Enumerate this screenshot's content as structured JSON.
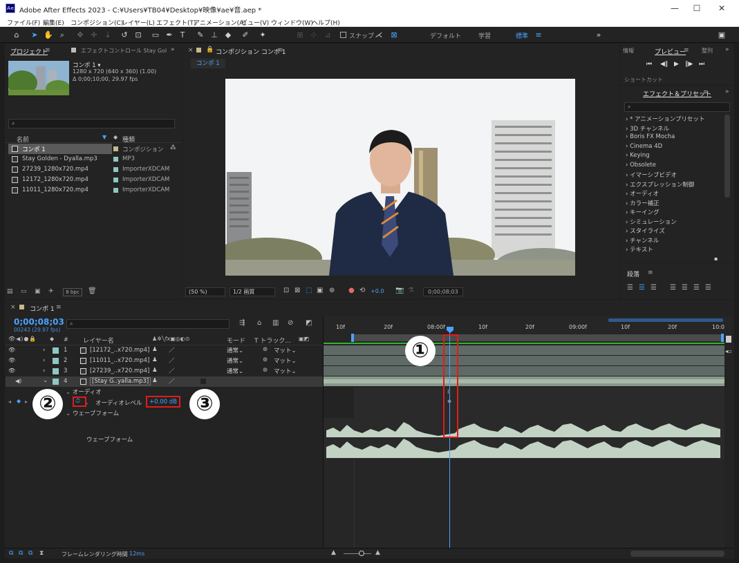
{
  "window": {
    "title": "Adobe After Effects 2023 - C:¥Users¥TB04¥Desktop¥映像¥ae¥音.aep *",
    "app_badge": "Ae",
    "minimize": "—",
    "maximize": "☐",
    "close": "✕"
  },
  "menu": [
    "ファイル(F)",
    "編集(E)",
    "コンポジション(C)",
    "レイヤー(L)",
    "エフェクト(T)",
    "アニメーション(A)",
    "ビュー(V)",
    "ウィンドウ(W)",
    "ヘルプ(H)"
  ],
  "toolbar": {
    "snap_label": "スナップ",
    "workspaces": [
      "デフォルト",
      "学習",
      "標準"
    ],
    "active_workspace": "標準"
  },
  "project_panel": {
    "tab_project": "プロジェクト",
    "tab_effect_controls": "エフェクトコントロール Stay Gol",
    "comp_name": "コンポ 1 ▾",
    "comp_size": "1280 x 720  (640 x 360) (1.00)",
    "comp_duration": "Δ 0;00;10;00, 29.97 fps",
    "search_placeholder": "",
    "col_name": "名前",
    "col_type": "種類",
    "items": [
      {
        "name": "コンポ 1",
        "type": "コンポジション",
        "color": "#c9b88c"
      },
      {
        "name": "Stay Golden - Dyalla.mp3",
        "type": "MP3",
        "color": "#8fc7c2"
      },
      {
        "name": "27239_1280x720.mp4",
        "type": "ImporterXDCAM",
        "color": "#8fc7c2"
      },
      {
        "name": "12172_1280x720.mp4",
        "type": "ImporterXDCAM",
        "color": "#8fc7c2"
      },
      {
        "name": "11011_1280x720.mp4",
        "type": "ImporterXDCAM",
        "color": "#8fc7c2"
      }
    ],
    "bpc": "8 bpc"
  },
  "comp_panel": {
    "tab_label": "コンポジション コンポ 1",
    "comp_chip": "コンポ 1",
    "zoom": "(50 %)",
    "resolution": "1/2 画質",
    "exposure": "+0.0",
    "timecode": "0;00;08;03"
  },
  "right_panel": {
    "tab_info": "情報",
    "tab_preview": "プレビュー",
    "tab_audio": "整列",
    "shortcut_label": "ショートカット",
    "effects_title": "エフェクト＆プリセット",
    "effects": [
      "* アニメーションプリセット",
      "3D チャンネル",
      "Boris FX Mocha",
      "Cinema 4D",
      "Keying",
      "Obsolete",
      "イマーシブビデオ",
      "エクスプレッション制御",
      "オーディオ",
      "カラー補正",
      "キーイング",
      "シミュレーション",
      "スタイライズ",
      "チャンネル",
      "テキスト"
    ],
    "paragraph_title": "段落"
  },
  "timeline": {
    "tab_label": "コンポ 1",
    "timecode": "0;00;08;03",
    "frame_info": "00243 (29.97 fps)",
    "col_layer_name": "レイヤー名",
    "col_mode": "モード",
    "col_track": "T  トラック...",
    "ruler_labels": [
      "10f",
      "20f",
      "08:00f",
      "10f",
      "20f",
      "09:00f",
      "10f",
      "20f",
      "10:0"
    ],
    "layers": [
      {
        "num": "1",
        "name": "[12172_..x720.mp4]",
        "mode": "通常",
        "track": "マット"
      },
      {
        "num": "2",
        "name": "[11011_..x720.mp4]",
        "mode": "通常",
        "track": "マット"
      },
      {
        "num": "3",
        "name": "[27239_..x720.mp4]",
        "mode": "通常",
        "track": "マット"
      },
      {
        "num": "4",
        "name": "[Stay G..yalla.mp3]",
        "mode": "",
        "track": ""
      }
    ],
    "audio_group": "オーディオ",
    "audio_level_label": "オーディオレベル",
    "audio_level_value": "+0.00 dB",
    "waveform_group": "ウェーブフォーム",
    "waveform_label": "ウェーブフォーム",
    "render_time_label": "フレームレンダリング時間",
    "render_time_value": "12ms"
  },
  "callouts": [
    "①",
    "②",
    "③"
  ]
}
